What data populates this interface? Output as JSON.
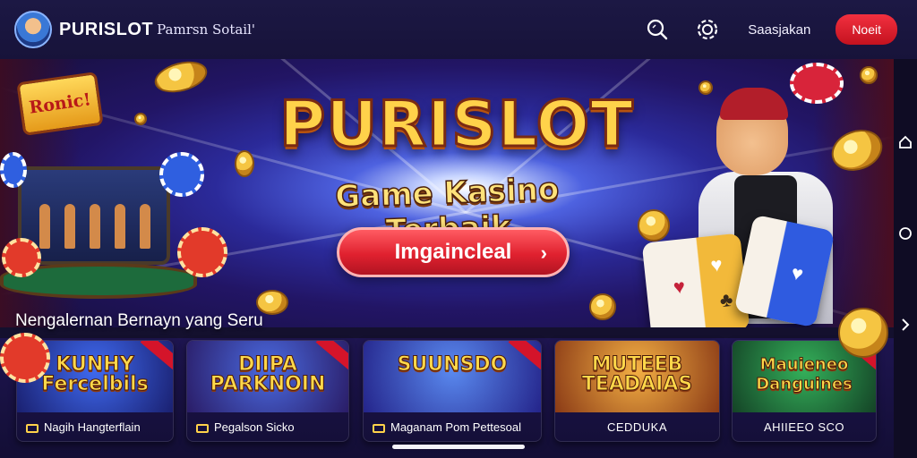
{
  "header": {
    "brand": "PURISLOT",
    "brand_sub": "Pamrsn Sotail'",
    "icons": [
      "search-icon",
      "chip-icon"
    ],
    "login_label": "Saasjakan",
    "signup_label": "Noeit"
  },
  "hero": {
    "badge": "Ronic!",
    "title": "PURISLOT",
    "subtitle": "Game Kasino Terbaik",
    "cta_label": "Imgaincleal",
    "cta_icon": "chevron-right-icon"
  },
  "sidenav": {
    "icons": [
      "home-icon",
      "circle-icon",
      "chevron-right-icon"
    ]
  },
  "section": {
    "title": "Nengalernan Bernayn yang Seru"
  },
  "games": [
    {
      "art_title": "KUNHY Fercelbils",
      "caption": "Nagih Hangterflain",
      "colors": [
        "#2a4fd0",
        "#1a2a8a"
      ]
    },
    {
      "art_title": "DIIPA PARKNOIN",
      "caption": "Pegalson Sicko",
      "colors": [
        "#3b58c8",
        "#2a1f6a"
      ]
    },
    {
      "art_title": "SUUNSDO",
      "caption": "Maganam Pom Pettesoal",
      "colors": [
        "#3f7ae0",
        "#2a2a8a"
      ]
    },
    {
      "art_title": "MUTEEB TEADAIAS",
      "caption": "CEDDUKA",
      "colors": [
        "#f0a13a",
        "#8a3a1a"
      ]
    },
    {
      "art_title": "Mauieneo Danguines",
      "caption": "AHIIEEO SCO",
      "colors": [
        "#2a9a4a",
        "#15452a"
      ]
    }
  ]
}
